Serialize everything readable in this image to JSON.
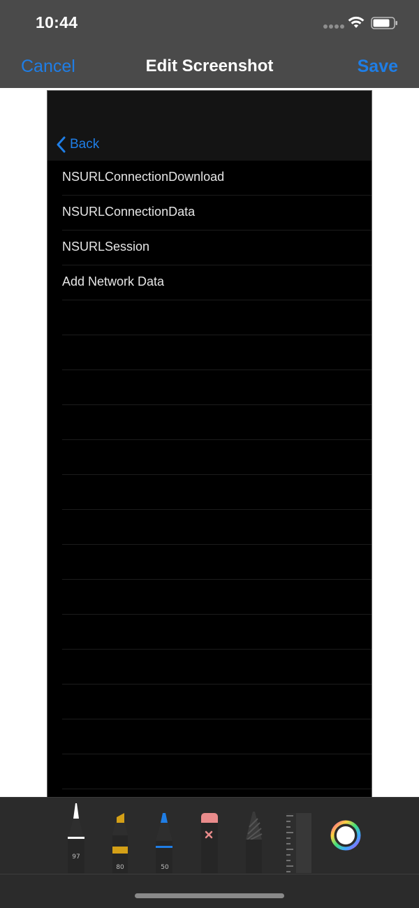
{
  "status_bar": {
    "time": "10:44"
  },
  "nav": {
    "cancel_label": "Cancel",
    "title": "Edit Screenshot",
    "save_label": "Save",
    "accent_color": "#1f7ee6"
  },
  "screenshot": {
    "back_label": "Back",
    "items": [
      {
        "label": "NSURLConnectionDownload"
      },
      {
        "label": "NSURLConnectionData"
      },
      {
        "label": "NSURLSession"
      },
      {
        "label": "Add Network Data"
      }
    ]
  },
  "tools": {
    "pen_value": "97",
    "marker_value": "80",
    "pencil_value": "50",
    "marker_color": "#d4a017",
    "pencil_color": "#1f7ee6",
    "icons": [
      "pen-icon",
      "marker-icon",
      "pencil-icon",
      "eraser-icon",
      "lasso-icon",
      "ruler-icon",
      "color-picker-icon"
    ]
  }
}
